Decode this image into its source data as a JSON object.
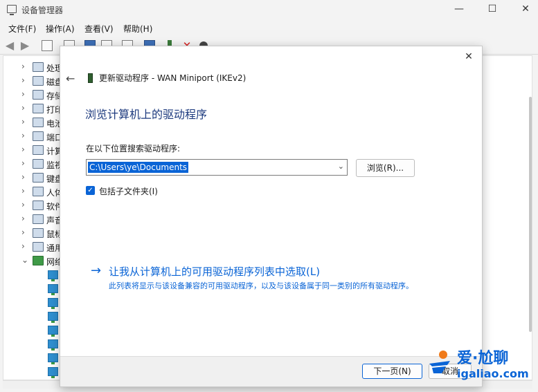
{
  "window": {
    "title": "设备管理器",
    "minimize": "—",
    "maximize": "☐",
    "close": "✕"
  },
  "menu": [
    "文件(F)",
    "操作(A)",
    "查看(V)",
    "帮助(H)"
  ],
  "tree": {
    "categories": [
      {
        "label": "处理",
        "expanded": false
      },
      {
        "label": "磁盘",
        "expanded": false
      },
      {
        "label": "存储",
        "expanded": false
      },
      {
        "label": "打印",
        "expanded": false
      },
      {
        "label": "电池",
        "expanded": false
      },
      {
        "label": "端口",
        "expanded": false
      },
      {
        "label": "计算",
        "expanded": false
      },
      {
        "label": "监视",
        "expanded": false
      },
      {
        "label": "键盘",
        "expanded": false
      },
      {
        "label": "人体",
        "expanded": false
      },
      {
        "label": "软件",
        "expanded": false
      },
      {
        "label": "声音",
        "expanded": false
      },
      {
        "label": "鼠标",
        "expanded": false
      },
      {
        "label": "通用",
        "expanded": false
      },
      {
        "label": "网络",
        "expanded": true
      }
    ],
    "network_child_count": 8
  },
  "dialog": {
    "close": "✕",
    "back": "←",
    "header": "更新驱动程序 - WAN Miniport (IKEv2)",
    "heading": "浏览计算机上的驱动程序",
    "location_label": "在以下位置搜索驱动程序:",
    "path_value": "C:\\Users\\ye\\Documents",
    "browse_label": "浏览(R)...",
    "include_subfolders_label": "包括子文件夹(I)",
    "include_subfolders_checked": true,
    "pick_link": "让我从计算机上的可用驱动程序列表中选取(L)",
    "pick_desc": "此列表将显示与该设备兼容的可用驱动程序，以及与该设备属于同一类别的所有驱动程序。",
    "next_label": "下一页(N)",
    "cancel_label": "取消"
  },
  "watermark": {
    "cn": "爱·尬聊",
    "url": "igaliao.com"
  },
  "colors": {
    "accent": "#0a64d6",
    "heading": "#1d3a7e"
  }
}
